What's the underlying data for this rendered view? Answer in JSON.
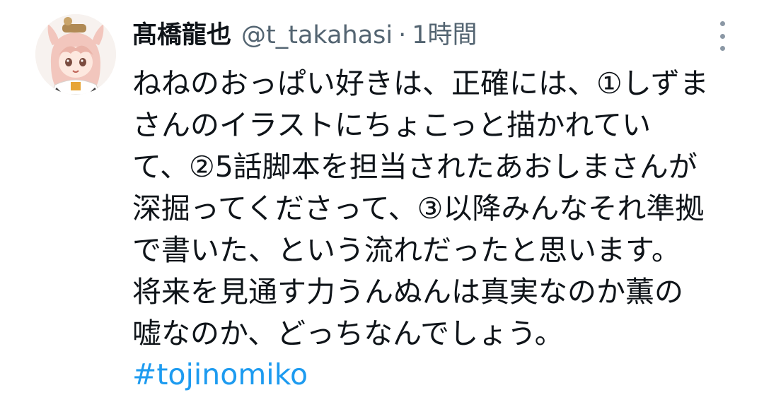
{
  "tweet": {
    "display_name": "髙橋龍也",
    "handle": "@t_takahasi",
    "separator": "·",
    "time": "1時間",
    "avatar_icon": "anime-character-avatar",
    "more_icon": "vertical-ellipsis-icon",
    "text_lines": [
      "ねねのおっぱい好きは、正確には、①しずま",
      "さんのイラストにちょこっと描かれてい",
      "て、②5話脚本を担当されたあおしまさんが",
      "深掘ってくださって、③以降みんなそれ準拠",
      "で書いた、という流れだったと思います。",
      "将来を見通す力うんぬんは真実なのか薫の",
      "嘘なのか、どっちなんでしょう。"
    ],
    "hashtag": "#tojinomiko"
  },
  "colors": {
    "text": "#0f1419",
    "secondary": "#536471",
    "link": "#1d9bf0"
  }
}
